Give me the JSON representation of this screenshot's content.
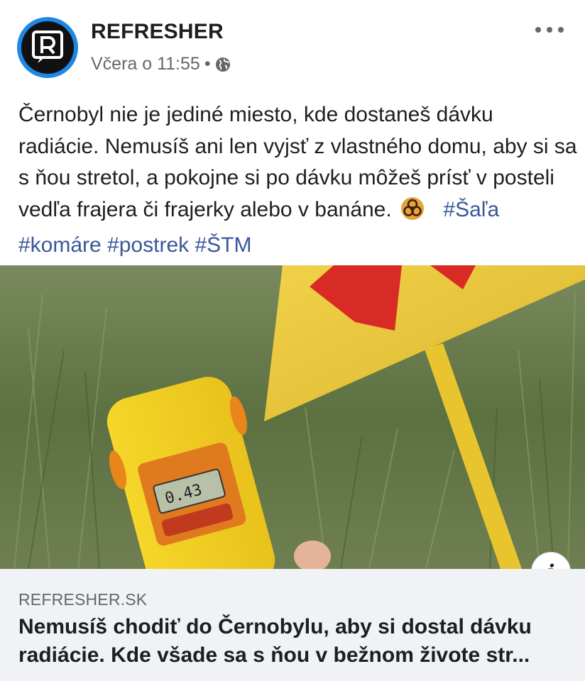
{
  "post": {
    "page_name": "REFRESHER",
    "timestamp": "Včera o 11:55",
    "separator": "•",
    "privacy_icon": "globe-icon",
    "more_icon": "more-options-icon",
    "text": "Černobyl nie je jediné miesto, kde dostaneš dávku radiácie. Nemusíš ani len vyjsť z vlastného domu, aby si sa s ňou stretol, a pokojne si po dávku môžeš prísť v posteli vedľa frajera či frajerky alebo v banáne.",
    "emoji": "biohazard-icon",
    "hashtags": [
      "#Šaľa",
      "#komáre",
      "#postrek",
      "#ŠTM"
    ]
  },
  "link": {
    "image": "dosimeter-radiation-sign-photo",
    "info_label": "i",
    "domain": "REFRESHER.SK",
    "title": "Nemusíš chodiť do Černobylu, aby si dostal dávku radiácie. Kde všade sa s ňou v bežnom živote str..."
  },
  "colors": {
    "hashtag": "#385898",
    "avatar_ring": "#1e88e5",
    "footer_bg": "#f0f2f5"
  }
}
